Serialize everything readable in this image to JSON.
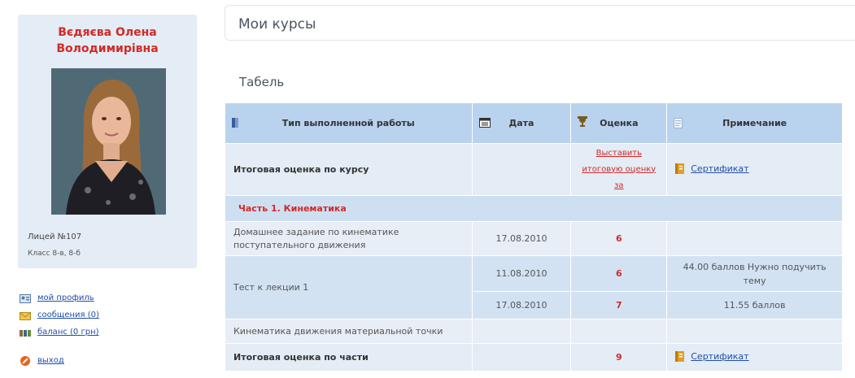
{
  "profile": {
    "name_line1": "Вєдяєва Олена",
    "name_line2": "Володимирівна",
    "school": "Лицей №107",
    "class": "Класс 8-в, 8-б"
  },
  "side_links": {
    "profile": "мой профиль",
    "messages": "сообщения (0)",
    "balance": "баланс (0 грн)",
    "exit": "выход"
  },
  "header": {
    "title": "Мои курсы"
  },
  "section": {
    "title": "Табель"
  },
  "table": {
    "headers": {
      "type": "Тип выполненной работы",
      "date": "Дата",
      "grade": "Оценка",
      "note": "Примечание"
    },
    "final_row": {
      "label": "Итоговая оценка по курсу",
      "action_line1": "Выставить",
      "action_line2": "итоговую оценку",
      "action_line3": "за",
      "certificate": "Сертификат"
    },
    "part_label": "Часть 1. Кинематика",
    "rows": [
      {
        "type": "Домашнее задание по кинематике поступательного движения",
        "date": "17.08.2010",
        "grade": "6",
        "note": ""
      },
      {
        "type": "Тест к лекции 1",
        "date": "11.08.2010",
        "grade": "6",
        "note": "44.00 баллов Нужно подучить тему"
      },
      {
        "type": "",
        "date": "17.08.2010",
        "grade": "7",
        "note": "11.55 баллов"
      },
      {
        "type": "Кинематика движения материальной точки",
        "date": "",
        "grade": "",
        "note": ""
      }
    ],
    "part_final": {
      "label": "Итоговая оценка по части",
      "grade": "9",
      "certificate": "Сертификат"
    }
  },
  "colors": {
    "accent_red": "#d12a26",
    "link_blue": "#1f4ea8",
    "header_bg": "#b9d2ee",
    "card_bg": "#e4ecf5"
  },
  "icons": {
    "type_header": "document-bar-icon",
    "date_header": "calendar-icon",
    "grade_header": "trophy-icon",
    "note_header": "note-icon",
    "profile": "user-card-icon",
    "messages": "envelope-icon",
    "balance": "wallet-icon",
    "exit": "no-entry-icon",
    "certificate": "certificate-icon"
  }
}
